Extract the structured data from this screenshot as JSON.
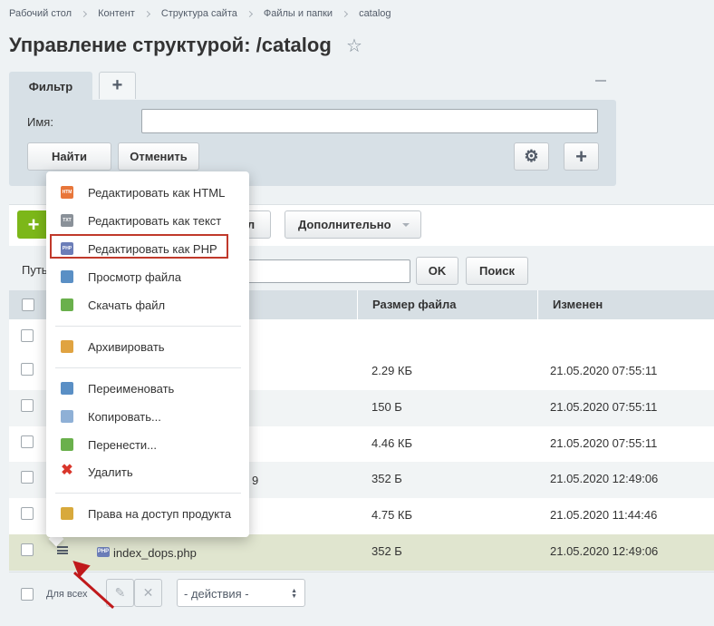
{
  "breadcrumb": [
    "Рабочий стол",
    "Контент",
    "Структура сайта",
    "Файлы и папки",
    "catalog"
  ],
  "page_title": "Управление структурой: /catalog",
  "filter": {
    "tab_label": "Фильтр",
    "add_tab_symbol": "+",
    "name_label": "Имя:",
    "name_value": "",
    "find_button": "Найти",
    "cancel_button": "Отменить",
    "add_button_symbol": "+"
  },
  "toolbar": {
    "add_button_symbol": "+",
    "hidden_button_partial": "л",
    "more_button": "Дополнительно",
    "path_label": "Путь",
    "path_value": "",
    "ok_button": "OK",
    "search_button": "Поиск"
  },
  "grid": {
    "columns": [
      "Размер файла",
      "Изменен"
    ],
    "rows": [
      {
        "size": "",
        "modified": ""
      },
      {
        "size": "2.29 КБ",
        "modified": "21.05.2020 07:55:11"
      },
      {
        "size": "150 Б",
        "modified": "21.05.2020 07:55:11"
      },
      {
        "size": "4.46 КБ",
        "modified": "21.05.2020 07:55:11"
      },
      {
        "size": "352 Б",
        "modified": "21.05.2020 12:49:06",
        "name_fragment": "9"
      },
      {
        "size": "4.75 КБ",
        "modified": "21.05.2020 11:44:46"
      },
      {
        "name": "index_dops.php",
        "size": "352 Б",
        "modified": "21.05.2020 12:49:06"
      }
    ]
  },
  "footer": {
    "for_all_label": "Для всех",
    "actions_placeholder": "- действия -"
  },
  "context_menu": {
    "items": [
      {
        "label": "Редактировать как HTML",
        "icon": "edit-html-icon",
        "icon_text": "HTM",
        "color": "#e8763a"
      },
      {
        "label": "Редактировать как текст",
        "icon": "edit-text-icon",
        "icon_text": "TXT",
        "color": "#8a9199"
      },
      {
        "label": "Редактировать как PHP",
        "icon": "edit-php-icon",
        "icon_text": "PHP",
        "color": "#6b7db8"
      },
      {
        "label": "Просмотр файла",
        "icon": "view-file-icon",
        "icon_text": "",
        "color": "#5a8fc5"
      },
      {
        "label": "Скачать файл",
        "icon": "download-file-icon",
        "icon_text": "",
        "color": "#6ab04c"
      },
      {
        "label": "Архивировать",
        "icon": "archive-icon",
        "icon_text": "",
        "color": "#e0a341"
      },
      {
        "label": "Переименовать",
        "icon": "rename-icon",
        "icon_text": "",
        "color": "#5a8fc5"
      },
      {
        "label": "Копировать...",
        "icon": "copy-icon",
        "icon_text": "",
        "color": "#8fb0d6"
      },
      {
        "label": "Перенести...",
        "icon": "move-icon",
        "icon_text": "",
        "color": "#6ab04c"
      },
      {
        "label": "Удалить",
        "icon": "delete-icon",
        "icon_text": "",
        "color": "#d9362b"
      },
      {
        "label": "Права на доступ продукта",
        "icon": "access-rights-icon",
        "icon_text": "",
        "color": "#d8a93c"
      }
    ]
  },
  "colors": {
    "accent_green": "#7cb719",
    "highlight_red": "#c0392b",
    "selected_row": "#e0e5cf"
  }
}
